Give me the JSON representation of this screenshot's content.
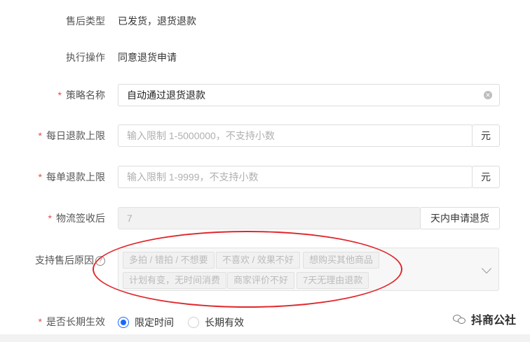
{
  "after_sales_type": {
    "label": "售后类型",
    "value": "已发货，退货退款"
  },
  "action": {
    "label": "执行操作",
    "value": "同意退货申请"
  },
  "strategy_name": {
    "required_mark": "*",
    "label": "策略名称",
    "value": "自动通过退货退款",
    "clear_icon": "clear-icon"
  },
  "daily_limit": {
    "required_mark": "*",
    "label": "每日退款上限",
    "placeholder": "输入限制 1-5000000，不支持小数",
    "unit": "元"
  },
  "order_limit": {
    "required_mark": "*",
    "label": "每单退款上限",
    "placeholder": "输入限制 1-9999，不支持小数",
    "unit": "元"
  },
  "logistics": {
    "required_mark": "*",
    "label": "物流签收后",
    "value": "7",
    "suffix": "天内申请退货"
  },
  "reasons": {
    "label": "支持售后原因",
    "help_icon": "help-icon",
    "tags": [
      "多拍 / 错拍 / 不想要",
      "不喜欢 / 效果不好",
      "想购买其他商品",
      "计划有变，无时间消费",
      "商家评价不好",
      "7天无理由退款"
    ],
    "dropdown_icon": "chevron-down-icon"
  },
  "long_term": {
    "required_mark": "*",
    "label": "是否长期生效",
    "options": [
      "限定时间",
      "长期有效"
    ],
    "selected": "限定时间"
  },
  "watermark": {
    "text": "抖商公社",
    "icon": "wechat-icon"
  },
  "colors": {
    "accent": "#1966ff",
    "required": "#e34d4d",
    "annotation": "#e0262b"
  }
}
